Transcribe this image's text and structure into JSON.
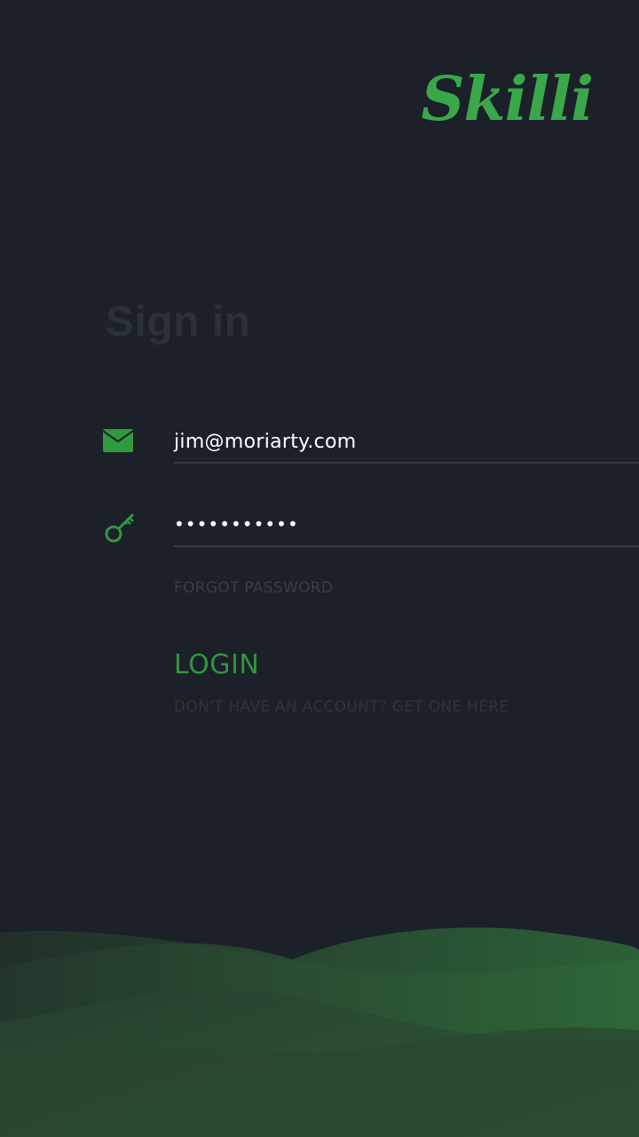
{
  "app": {
    "logo": "Skilli"
  },
  "form": {
    "title": "Sign in",
    "email_value": "jim@moriarty.com",
    "password_value": "•••••••••••",
    "forgot_label": "FORGOT PASSWORD",
    "login_label": "LOGIN",
    "signup_label": "DON'T HAVE AN ACCOUNT? GET ONE HERE"
  },
  "colors": {
    "background": "#1b2029",
    "accent": "#3aa84a",
    "muted_text": "#373e48"
  },
  "icons": {
    "email": "envelope-icon",
    "password": "key-icon"
  }
}
